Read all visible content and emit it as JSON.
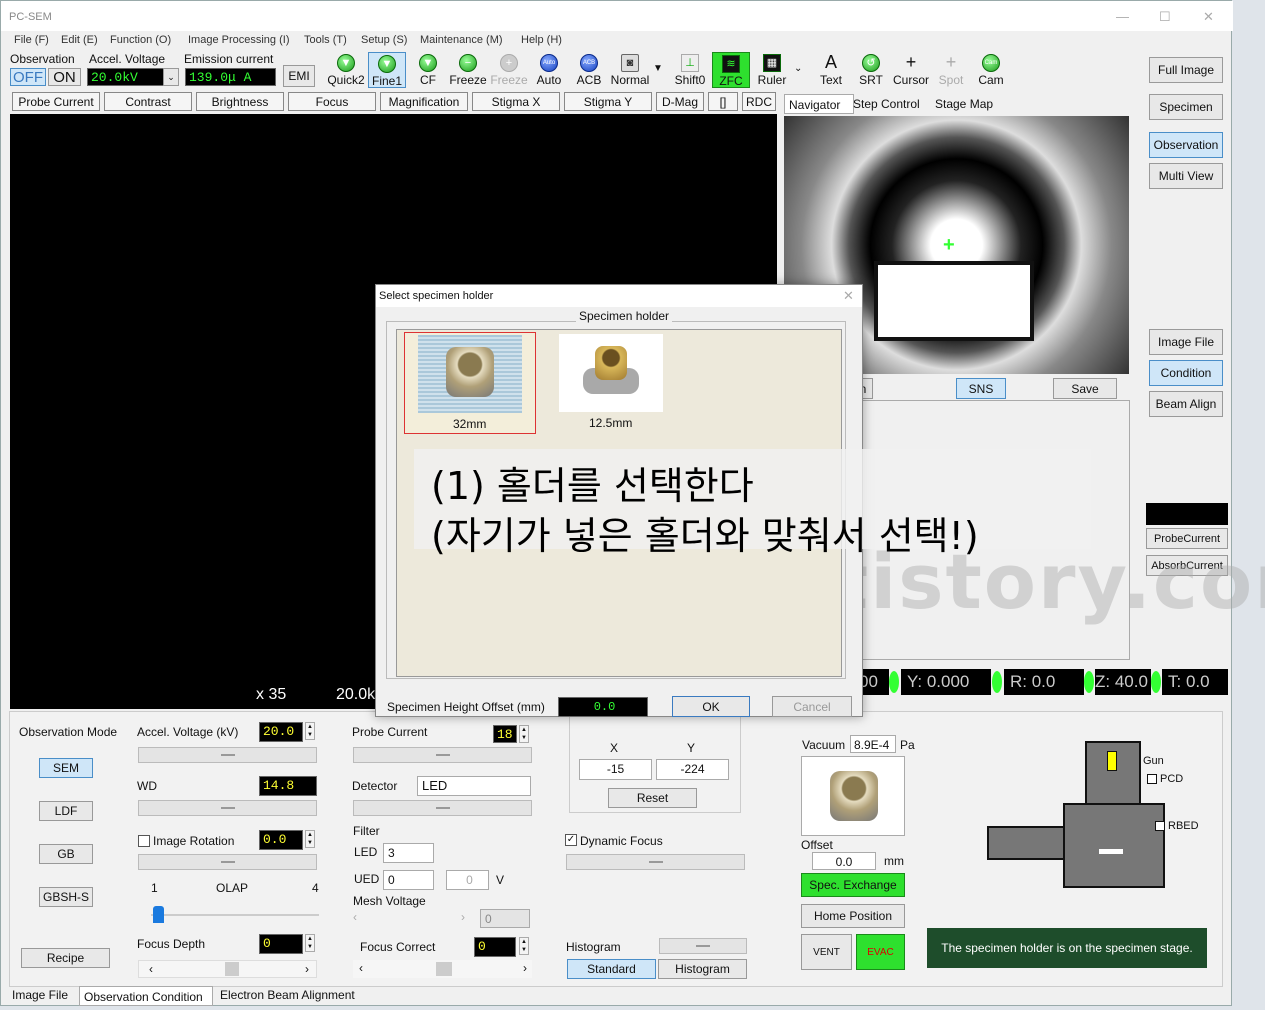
{
  "app": {
    "title": "PC-SEM"
  },
  "menu": [
    "File (F)",
    "Edit (E)",
    "Function (O)",
    "Image Processing (I)",
    "Tools (T)",
    "Setup (S)",
    "Maintenance (M)",
    "Help (H)"
  ],
  "top": {
    "observation_label": "Observation",
    "off": "OFF",
    "on": "ON",
    "accel_label": "Accel. Voltage",
    "accel_value": "20.0kV",
    "emission_label": "Emission current",
    "emission_value": "139.0μ A",
    "emi": "EMI"
  },
  "toolbar": [
    "Quick2",
    "Fine1",
    "CF",
    "Freeze",
    "Freeze",
    "Auto",
    "ACB",
    "Normal",
    "Shift0",
    "ZFC",
    "Ruler",
    "Text",
    "SRT",
    "Cursor",
    "Spot",
    "Cam"
  ],
  "tabs": [
    "Probe Current",
    "Contrast",
    "Brightness",
    "Focus",
    "Magnification",
    "Stigma X",
    "Stigma Y",
    "D-Mag",
    "[]",
    "RDC"
  ],
  "right_buttons": [
    "Full Image",
    "Specimen",
    "Observation",
    "Multi View",
    "Image File",
    "Condition",
    "Beam Align"
  ],
  "nav_tabs": [
    "Navigator",
    "Step Control",
    "Stage Map"
  ],
  "nav_buttons": {
    "n": "n",
    "sns": "SNS",
    "save": "Save"
  },
  "probe_panel": {
    "probe": "ProbeCurrent",
    "absorb": "AbsorbCurrent"
  },
  "image": {
    "mag": "x 35",
    "kv": "20.0k"
  },
  "stage": {
    "x": "00",
    "y": "Y: 0.000",
    "r": "R: 0.0",
    "z": "Z: 40.0",
    "t": "T: 0.0"
  },
  "dialog": {
    "title": "Select specimen holder",
    "group": "Specimen holder",
    "holders": [
      "32mm",
      "12.5mm"
    ],
    "height_label": "Specimen Height Offset (mm)",
    "height_value": "0.0",
    "ok": "OK",
    "cancel": "Cancel"
  },
  "annotation": {
    "line1": "(1) 홀더를 선택한다",
    "line2": "(자기가 넣은 홀더와 맞춰서 선택!)",
    "watermark": "greenbug.tistory.com"
  },
  "obs_mode": {
    "label": "Observation Mode",
    "modes": [
      "SEM",
      "LDF",
      "GB",
      "GBSH-S"
    ],
    "recipe": "Recipe"
  },
  "params": {
    "accel_label": "Accel. Voltage (kV)",
    "accel": "20.0",
    "wd_label": "WD",
    "wd": "14.8",
    "rot_label": "Image Rotation",
    "rot": "0.0",
    "olap_min": "1",
    "olap_label": "OLAP",
    "olap_max": "4",
    "depth_label": "Focus Depth",
    "depth": "0"
  },
  "probe": {
    "label": "Probe Current",
    "value": "18",
    "detector_label": "Detector",
    "detector": "LED",
    "filter_label": "Filter",
    "led_label": "LED",
    "led": "3",
    "ued_label": "UED",
    "ued": "0",
    "ued_v": "0",
    "v": "V",
    "mesh_label": "Mesh Voltage",
    "mesh": "0",
    "fc_label": "Focus Correct",
    "fc": "0"
  },
  "stigma": {
    "x_label": "X",
    "y_label": "Y",
    "x": "-15",
    "y": "-224",
    "reset": "Reset",
    "dynamic": "Dynamic Focus",
    "hist_label": "Histogram",
    "standard": "Standard",
    "histogram": "Histogram"
  },
  "spec": {
    "vacuum_label": "Vacuum",
    "vacuum": "8.9E-4",
    "pa": "Pa",
    "offset_label": "Offset",
    "offset": "0.0",
    "mm": "mm",
    "exchange": "Spec. Exchange",
    "home": "Home Position",
    "vent": "VENT",
    "evac": "EVAC",
    "gun": "Gun",
    "pcd": "PCD",
    "rbed": "RBED",
    "msg": "The specimen holder is on the specimen stage."
  },
  "bottom_tabs": [
    "Image File",
    "Observation Condition",
    "Electron Beam Alignment"
  ]
}
